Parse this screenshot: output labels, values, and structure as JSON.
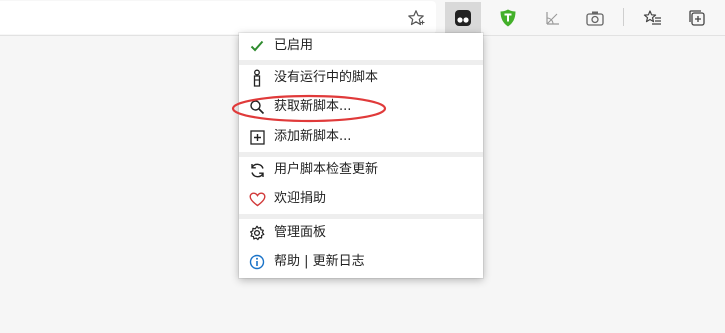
{
  "toolbar": {
    "icons": [
      "favorite-star-icon",
      "tampermonkey-icon",
      "adguard-icon",
      "protractor-icon",
      "camera-icon",
      "favorites-list-icon",
      "collections-icon"
    ],
    "accent_active_bg": "#d9d9d9"
  },
  "menu": {
    "enabled_label": "已启用",
    "no_running_label": "没有运行中的脚本",
    "get_new_label": "获取新脚本...",
    "add_new_label": "添加新脚本...",
    "check_updates_label": "用户脚本检查更新",
    "donate_label": "欢迎捐助",
    "dashboard_label": "管理面板",
    "help_label": "帮助 | 更新日志"
  },
  "colors": {
    "check": "#2e8b2e",
    "heart": "#d13a3a",
    "info": "#1a73c8",
    "annotation": "#e03a3a",
    "adguard": "#43b02a"
  }
}
